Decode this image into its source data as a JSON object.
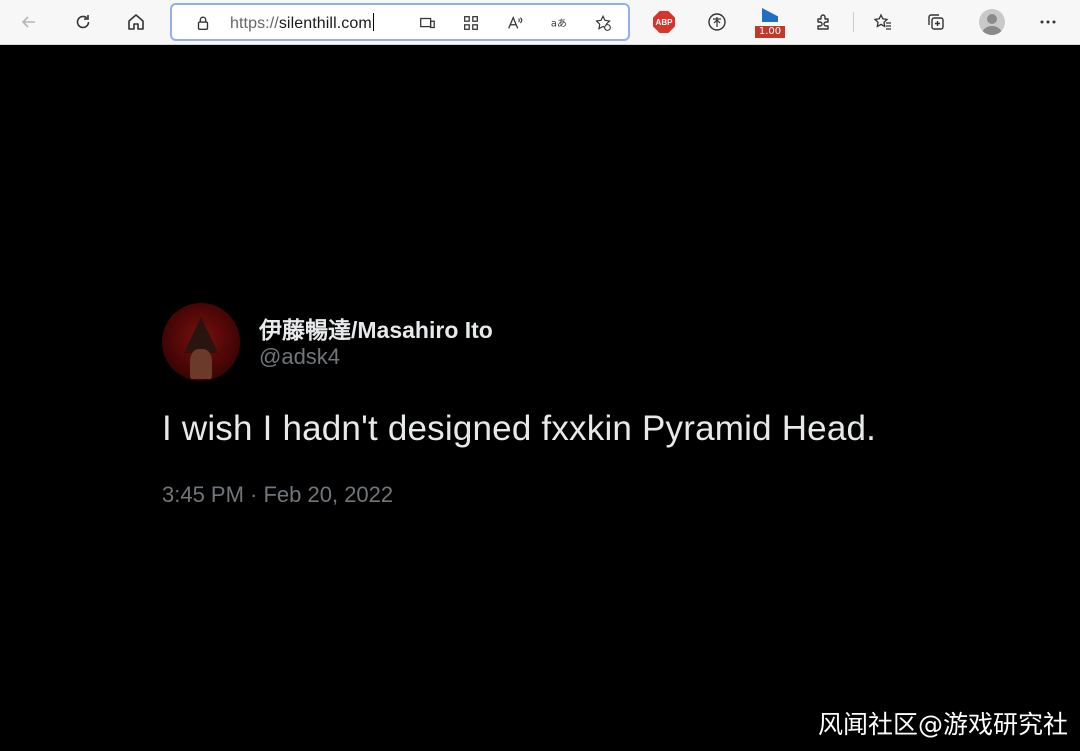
{
  "browser": {
    "url_scheme": "https://",
    "url_host": "silenthill.com",
    "extensions": {
      "adblock_label": "ABP",
      "speed_badge": "1.00"
    },
    "icons": {
      "back": "arrow-left-icon",
      "refresh": "refresh-icon",
      "home": "home-icon",
      "lock": "lock-icon",
      "app_available": "app-available-icon",
      "qr": "qr-code-icon",
      "read_aloud": "read-aloud-icon",
      "translate": "translate-icon",
      "add_favorite": "add-favorite-icon",
      "extensions": "puzzle-icon",
      "favorites": "favorites-icon",
      "collections": "collections-icon",
      "profile": "profile-icon",
      "menu": "more-icon"
    }
  },
  "tweet": {
    "display_name": "伊藤暢達/Masahiro Ito",
    "handle": "@adsk4",
    "text": "I wish I hadn't designed fxxkin Pyramid Head.",
    "timestamp": "3:45 PM · Feb 20, 2022"
  },
  "watermark": "风闻社区@游戏研究社",
  "colors": {
    "page_bg": "#000000",
    "text_primary": "#e7e9ea",
    "text_secondary": "#71767b",
    "address_border": "#8fb0e8"
  }
}
